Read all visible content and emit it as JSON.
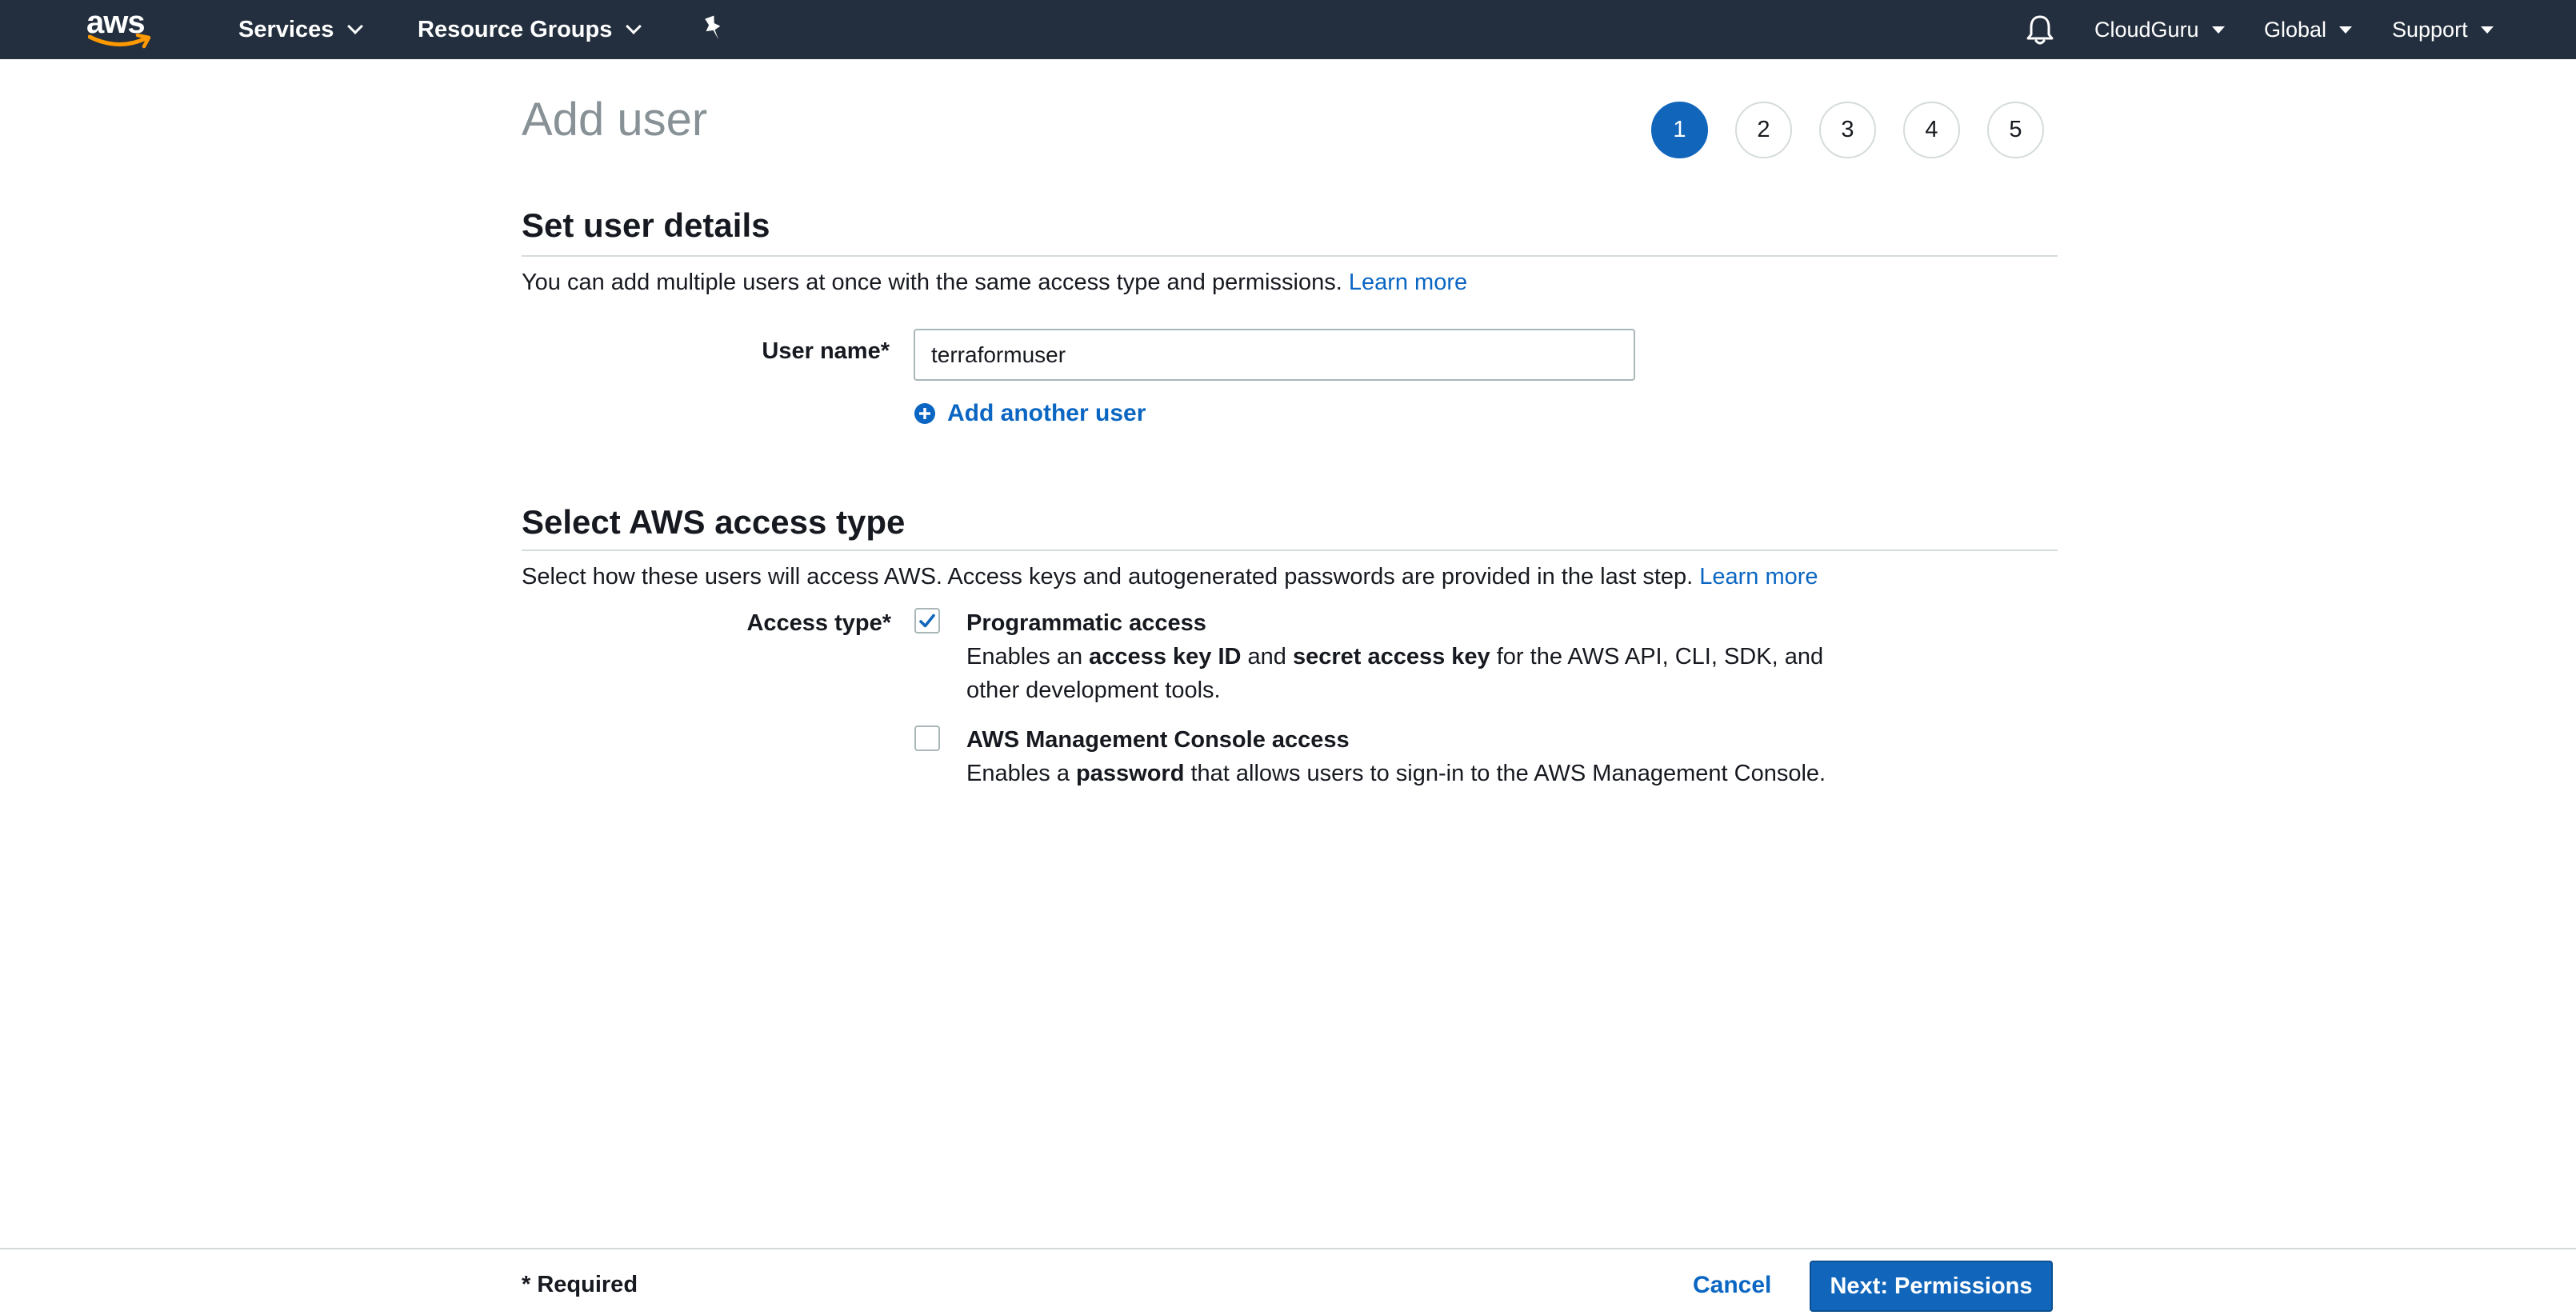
{
  "topnav": {
    "logo_text": "aws",
    "services_label": "Services",
    "resource_groups_label": "Resource Groups",
    "account_label": "CloudGuru",
    "region_label": "Global",
    "support_label": "Support"
  },
  "wizard": {
    "title": "Add user",
    "steps": [
      "1",
      "2",
      "3",
      "4",
      "5"
    ],
    "current_step": 1
  },
  "user_details": {
    "section_title": "Set user details",
    "description": "You can add multiple users at once with the same access type and permissions.",
    "learn_more": "Learn more",
    "user_name_label": "User name*",
    "user_name_value": "terraformuser",
    "add_another_user": "Add another user"
  },
  "access_type": {
    "section_title": "Select AWS access type",
    "description": "Select how these users will access AWS. Access keys and autogenerated passwords are provided in the last step.",
    "learn_more": "Learn more",
    "label": "Access type*",
    "options": [
      {
        "title": "Programmatic access",
        "checked": true,
        "desc_pre": "Enables an ",
        "desc_b1": "access key ID",
        "desc_mid": " and ",
        "desc_b2": "secret access key",
        "desc_post": " for the AWS API, CLI, SDK, and other development tools."
      },
      {
        "title": "AWS Management Console access",
        "checked": false,
        "desc_pre": "Enables a ",
        "desc_b1": "password",
        "desc_post": " that allows users to sign-in to the AWS Management Console."
      }
    ]
  },
  "footer": {
    "required_note": "* Required",
    "cancel_label": "Cancel",
    "next_label": "Next: Permissions"
  },
  "colors": {
    "nav_bg": "#232f3e",
    "accent": "#1166bb",
    "link": "#0a66c2",
    "aws_smile": "#ff9900"
  }
}
